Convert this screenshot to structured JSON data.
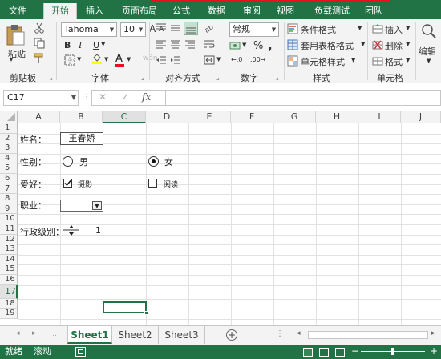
{
  "tabs": [
    "文件",
    "开始",
    "插入",
    "页面布局",
    "公式",
    "数据",
    "审阅",
    "视图",
    "负载测试",
    "团队"
  ],
  "clipboard": {
    "paste": "粘贴",
    "group": "剪贴板"
  },
  "font": {
    "name": "Tahoma",
    "size": "10",
    "bold": "B",
    "italic": "I",
    "underline": "U",
    "grow": "A",
    "shrink": "A",
    "color_letter": "A",
    "group": "字体"
  },
  "alignment": {
    "group": "对齐方式"
  },
  "number": {
    "format": "常规",
    "percent": "%",
    "comma": ",",
    "group": "数字"
  },
  "styles": {
    "conditional": "条件格式",
    "table": "套用表格格式",
    "cell": "单元格样式",
    "group": "样式"
  },
  "cells": {
    "insert": "插入",
    "delete": "删除",
    "format": "格式",
    "group": "单元格"
  },
  "editing": {
    "label": "编辑"
  },
  "namebox": "C17",
  "fx": "fx",
  "columns": [
    "A",
    "B",
    "C",
    "D",
    "E",
    "F",
    "G",
    "H",
    "I",
    "J"
  ],
  "rows": [
    "1",
    "2",
    "3",
    "4",
    "5",
    "6",
    "7",
    "8",
    "9",
    "10",
    "11",
    "12",
    "13",
    "14",
    "15",
    "16",
    "17",
    "18",
    "19"
  ],
  "form": {
    "name_label": "姓名：",
    "name_value": "王春娇",
    "gender_label": "性别：",
    "male": "男",
    "female": "女",
    "hobby_label": "爱好：",
    "hobby1": "摄影",
    "hobby2": "阅读",
    "job_label": "职业：",
    "level_label": "行政级别：",
    "level_value": "1"
  },
  "sheets": [
    "Sheet1",
    "Sheet2",
    "Sheet3"
  ],
  "status": {
    "ready": "就绪",
    "scroll": "滚动"
  },
  "colors": {
    "accent": "#217346",
    "red": "#e81123"
  }
}
